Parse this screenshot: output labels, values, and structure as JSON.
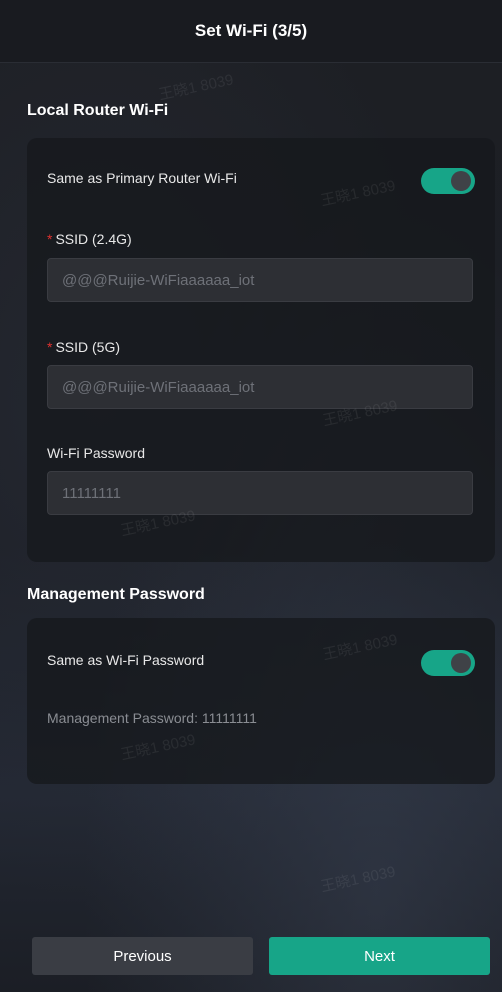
{
  "header": {
    "title": "Set Wi-Fi (3/5)"
  },
  "local_router": {
    "section_title": "Local Router Wi-Fi",
    "same_as_primary_label": "Same as Primary Router Wi-Fi",
    "same_as_primary_enabled": true,
    "ssid_24_label": "SSID (2.4G)",
    "ssid_24_value": "@@@Ruijie-WiFiaaaaaa_iot",
    "ssid_5_label": "SSID (5G)",
    "ssid_5_value": "@@@Ruijie-WiFiaaaaaa_iot",
    "wifi_password_label": "Wi-Fi Password",
    "wifi_password_value": "11111111",
    "required_marker": "*"
  },
  "management": {
    "section_title": "Management Password",
    "same_as_wifi_label": "Same as Wi-Fi Password",
    "same_as_wifi_enabled": true,
    "password_text": "Management Password: 11111111"
  },
  "footer": {
    "previous_label": "Previous",
    "next_label": "Next"
  },
  "watermark_text": "王晓1 8039",
  "colors": {
    "accent": "#17a588",
    "required": "#e0312f",
    "background": "#1c1f26",
    "card": "#16181c"
  }
}
